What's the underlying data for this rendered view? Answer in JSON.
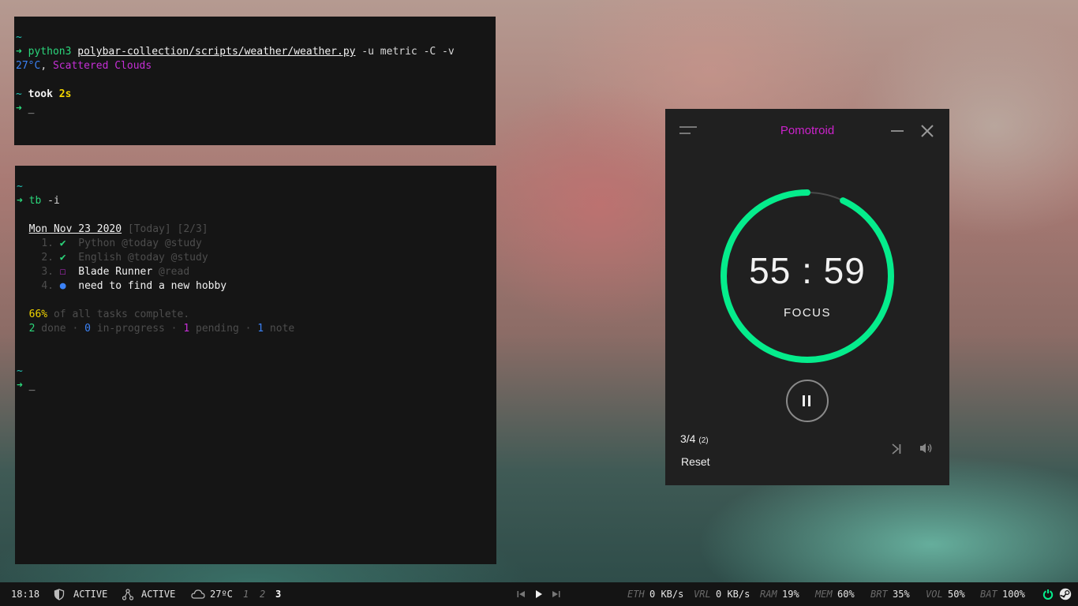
{
  "terminal1": {
    "lines": [
      {
        "tilde": "~"
      },
      {
        "arrow": "➜",
        "cmd": "python3",
        "path": "polybar-collection/scripts/weather/weather.py",
        "args": " -u metric -C -v"
      },
      {
        "temp": "27°C",
        "sep": ", ",
        "desc": "Scattered Clouds"
      },
      {
        "blank": ""
      },
      {
        "tilde": "~",
        "took": " took ",
        "time": "2s"
      },
      {
        "arrow": "➜",
        "cursor": "_"
      }
    ]
  },
  "terminal2": {
    "tilde1": "~",
    "arrow1": "➜",
    "cmd": "tb",
    "cmd_args": " -i",
    "date_header": "Mon Nov 23 2020",
    "date_meta": " [Today] [2/3]",
    "tasks": [
      {
        "num": "1.",
        "mark": "✔",
        "text": "Python @today @study"
      },
      {
        "num": "2.",
        "mark": "✔",
        "text": "English @today @study"
      },
      {
        "num": "3.",
        "mark": "☐",
        "text": "Blade Runner",
        "tag": " @read"
      },
      {
        "num": "4.",
        "mark": "●",
        "text": "need to find a new hobby"
      }
    ],
    "percent": "66%",
    "percent_text": " of all tasks complete.",
    "stats": {
      "done_n": "2",
      "done": " done · ",
      "prog_n": "0",
      "prog": " in-progress · ",
      "pend_n": "1",
      "pend": " pending · ",
      "note_n": "1",
      "note": " note"
    },
    "tilde2": "~",
    "arrow2": "➜",
    "cursor": "_"
  },
  "pomodoro": {
    "title": "Pomotroid",
    "time": "55 : 59",
    "mode": "FOCUS",
    "round": "3/4",
    "round_extra": "(2)",
    "reset_label": "Reset",
    "progress": 0.93,
    "accent_color": "#05ec8c",
    "title_color": "#cc22cc"
  },
  "statusbar": {
    "clock": "18:18",
    "vpn1_status": "ACTIVE",
    "vpn2_status": "ACTIVE",
    "weather": "27ºC",
    "workspaces": [
      "1",
      "2",
      "3"
    ],
    "eth_label": "ETH",
    "eth_value": "0 KB/s",
    "vrl_label": "VRL",
    "vrl_value": "0 KB/s",
    "ram_label": "RAM",
    "ram_value": "19%",
    "mem_label": "MEM",
    "mem_value": "60%",
    "brt_label": "BRT",
    "brt_value": "35%",
    "vol_label": "VOL",
    "vol_value": "50%",
    "bat_label": "BAT",
    "bat_value": "100%",
    "icons": [
      "shield-icon",
      "network-icon",
      "cloud-icon",
      "prev-icon",
      "play-icon",
      "next-icon",
      "power-icon",
      "steam-icon"
    ]
  }
}
